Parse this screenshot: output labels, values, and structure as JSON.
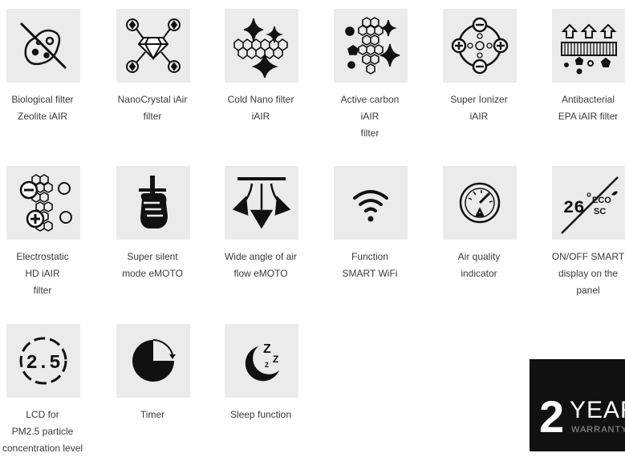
{
  "features": [
    {
      "label": "Biological filter\nZeolite iAIR",
      "icon": "biological-filter-icon"
    },
    {
      "label": "NanoCrystal iAir\nfilter",
      "icon": "nanocrystal-icon"
    },
    {
      "label": "Cold Nano filter\niAIR",
      "icon": "cold-nano-icon"
    },
    {
      "label": "Active carbon\niAIR\nfilter",
      "icon": "active-carbon-icon"
    },
    {
      "label": "Super Ionizer\niAIR",
      "icon": "ionizer-icon"
    },
    {
      "label": "Antibacterial\nEPA iAIR filter",
      "icon": "antibacterial-icon"
    },
    {
      "label": "Electrostatic\nHD iAIR\nfilter",
      "icon": "electrostatic-icon"
    },
    {
      "label": "Super silent\nmode eMOTO",
      "icon": "silent-mode-icon"
    },
    {
      "label": "Wide angle of air\nflow eMOTO",
      "icon": "wide-airflow-icon"
    },
    {
      "label": "Function\nSMART WiFi",
      "icon": "wifi-icon"
    },
    {
      "label": "Air quality\nindicator",
      "icon": "air-quality-gauge-icon"
    },
    {
      "label": "ON/OFF SMART\ndisplay on the\npanel",
      "icon": "smart-display-icon"
    },
    {
      "label": "LCD for\nPM2.5 particle\nconcentration level",
      "icon": "lcd-pm25-icon"
    },
    {
      "label": "Timer",
      "icon": "timer-icon"
    },
    {
      "label": "Sleep function",
      "icon": "sleep-icon"
    }
  ],
  "icon_text": {
    "lcd_value": "2.5",
    "display_temp": "26",
    "display_eco": "ECO",
    "display_sc": "SC",
    "sleep_z": "Z"
  },
  "warranty": {
    "number": "2",
    "years": "YEARS",
    "sub": "WARRANTY"
  }
}
